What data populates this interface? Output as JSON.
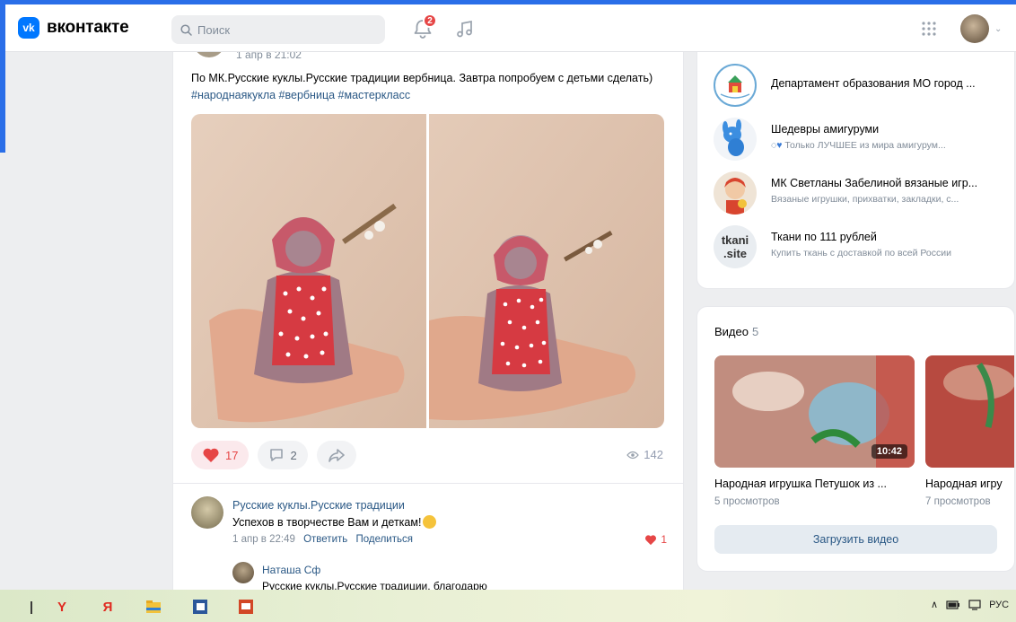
{
  "header": {
    "logo_badge": "vk",
    "logo_text": "вконтакте",
    "search_placeholder": "Поиск",
    "notifications_count": "2"
  },
  "post": {
    "date": "1 апр в 21:02",
    "text": "По МК.Русские куклы.Русские традиции вербница. Завтра попробуем с детьми сделать)",
    "hashtags": "#народнаякукла #вербница #мастеркласс",
    "likes": "17",
    "comments": "2",
    "views": "142"
  },
  "comment": {
    "author": "Русские куклы.Русские традиции",
    "text": "Успехов в творчестве Вам и деткам!",
    "date": "1 апр в 22:49",
    "reply_label": "Ответить",
    "share_label": "Поделиться",
    "likes": "1"
  },
  "reply": {
    "author": "Наташа Сф",
    "text": "Русские куклы.Русские традиции, благодарю"
  },
  "groups": [
    {
      "name": "Департамент образования МО город ...",
      "sub": ""
    },
    {
      "name": "Шедевры амигуруми",
      "sub": "Только ЛУЧШЕЕ из мира амигурум..."
    },
    {
      "name": "МК Светланы Забелиной вязаные игр...",
      "sub": "Вязаные игрушки, прихватки, закладки, с..."
    },
    {
      "name": "Ткани по 111 рублей",
      "sub": "Купить ткань с доставкой по всей России",
      "avatar_text_1": "tkani",
      "avatar_text_2": ".site"
    }
  ],
  "videos": {
    "title": "Видео",
    "count": "5",
    "items": [
      {
        "name": "Народная игрушка Петушок из ...",
        "views": "5 просмотров",
        "duration": "10:42"
      },
      {
        "name": "Народная игру",
        "views": "7 просмотров"
      }
    ],
    "upload_label": "Загрузить видео"
  },
  "taskbar": {
    "lang": "РУС"
  },
  "colors": {
    "accent": "#0077ff",
    "link": "#2a5885",
    "like": "#e64646"
  }
}
